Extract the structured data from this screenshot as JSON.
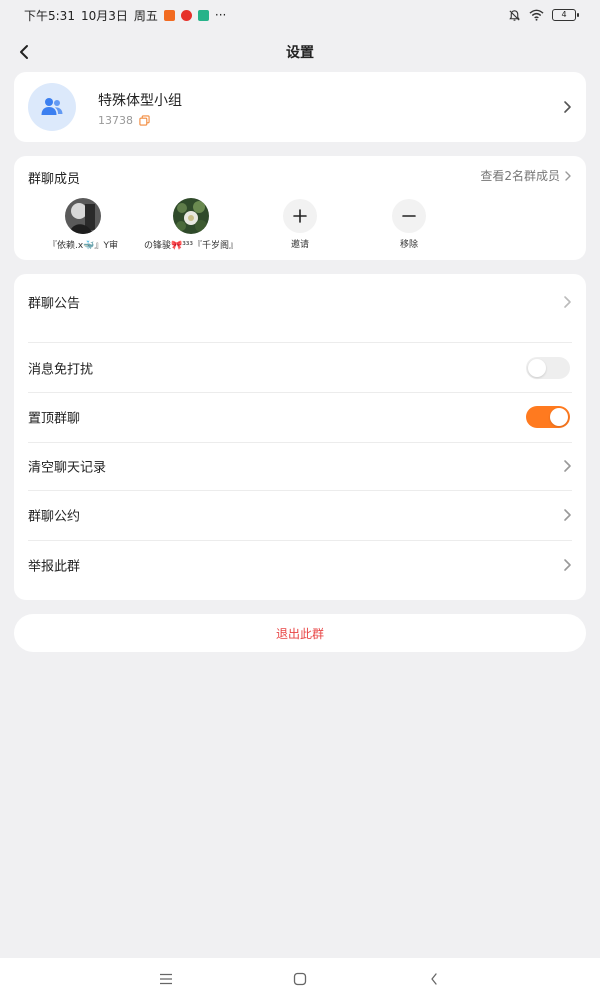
{
  "status": {
    "time": "下午5:31",
    "date": "10月3日",
    "weekday": "周五",
    "more": "···",
    "battery": "4"
  },
  "header": {
    "title": "设置"
  },
  "group": {
    "name": "特殊体型小组",
    "id": "13738"
  },
  "members": {
    "title": "群聊成员",
    "view_all": "查看2名群成员",
    "list": [
      {
        "name": "『依赖.x🐳』Y审"
      },
      {
        "name": "の锋骏🎀³³³『千岁阁』"
      }
    ],
    "invite": "邀请",
    "remove": "移除"
  },
  "settings": {
    "announcement": "群聊公告",
    "mute": "消息免打扰",
    "mute_on": false,
    "pin": "置顶群聊",
    "pin_on": true,
    "clear_history": "清空聊天记录",
    "rules": "群聊公约",
    "report": "举报此群"
  },
  "exit_label": "退出此群",
  "colors": {
    "accent": "#ff7a1f",
    "danger": "#e84545",
    "avatar_bg": "#dce9fb",
    "avatar_icon": "#3b7ff0"
  }
}
